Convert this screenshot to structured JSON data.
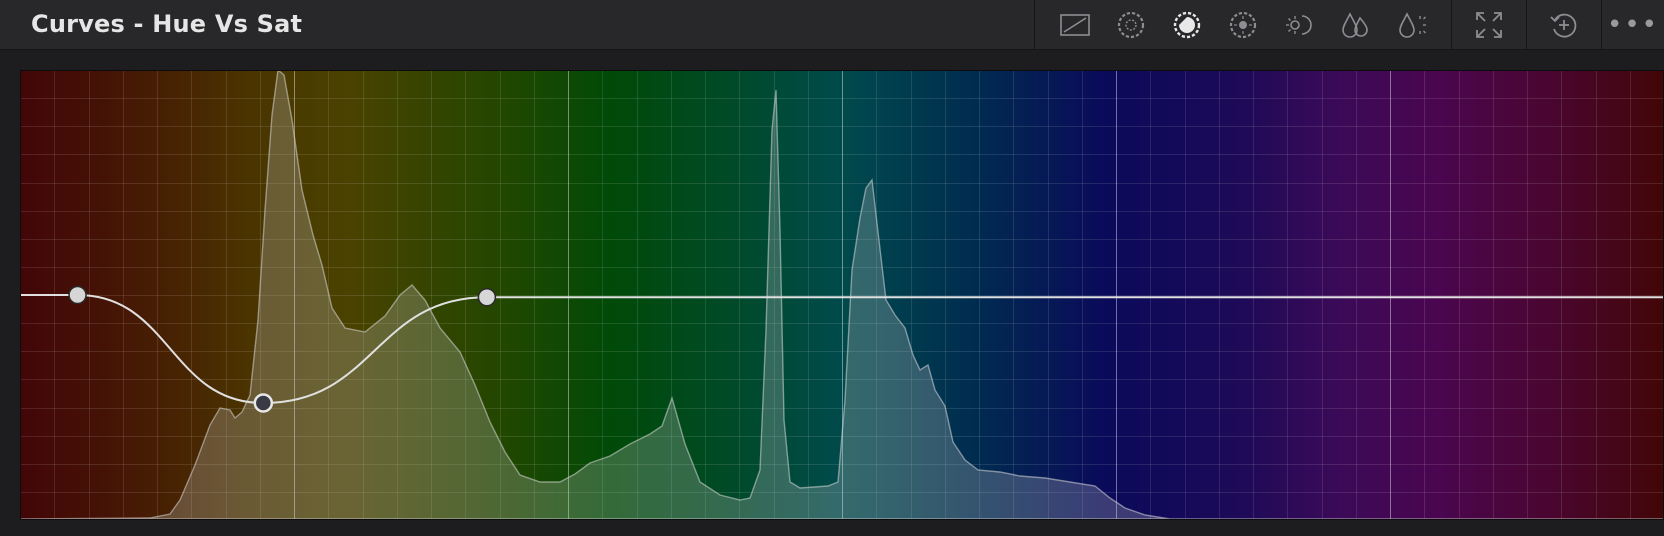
{
  "header": {
    "title": "Curves - Hue Vs Sat"
  },
  "toolbar": {
    "icons": [
      "custom-curve-icon",
      "hue-vs-hue-icon",
      "hue-vs-sat-icon",
      "hue-vs-lum-icon",
      "lum-vs-sat-icon",
      "sat-vs-sat-icon",
      "sat-vs-lum-icon",
      "expand-icon",
      "reset-icon",
      "more-options-icon"
    ],
    "active": "hue-vs-sat-icon",
    "more_label": "•••"
  },
  "colors": {
    "accent_active": "#e8e8e8",
    "icon_default": "#8d8d92",
    "curve": "#e0e0e0",
    "control_point": "#d6d6d6"
  },
  "curve": {
    "control_points": [
      {
        "hue": 0.035,
        "sat": 0.5
      },
      {
        "hue": 0.148,
        "sat": 0.26
      },
      {
        "hue": 0.284,
        "sat": 0.495
      }
    ]
  },
  "spectrum": {
    "stops": [
      {
        "at": 0.0,
        "color": "#420607"
      },
      {
        "at": 0.05,
        "color": "#451206"
      },
      {
        "at": 0.14,
        "color": "#4a3400"
      },
      {
        "at": 0.2,
        "color": "#4a4200"
      },
      {
        "at": 0.3,
        "color": "#1f4700"
      },
      {
        "at": 0.36,
        "color": "#004a08"
      },
      {
        "at": 0.42,
        "color": "#004a22"
      },
      {
        "at": 0.5,
        "color": "#004a4c"
      },
      {
        "at": 0.58,
        "color": "#002c50"
      },
      {
        "at": 0.66,
        "color": "#0a0a5a"
      },
      {
        "at": 0.74,
        "color": "#1c0a58"
      },
      {
        "at": 0.8,
        "color": "#3a0a58"
      },
      {
        "at": 0.86,
        "color": "#4a0650"
      },
      {
        "at": 0.93,
        "color": "#4a0630"
      },
      {
        "at": 1.0,
        "color": "#420607"
      }
    ]
  }
}
